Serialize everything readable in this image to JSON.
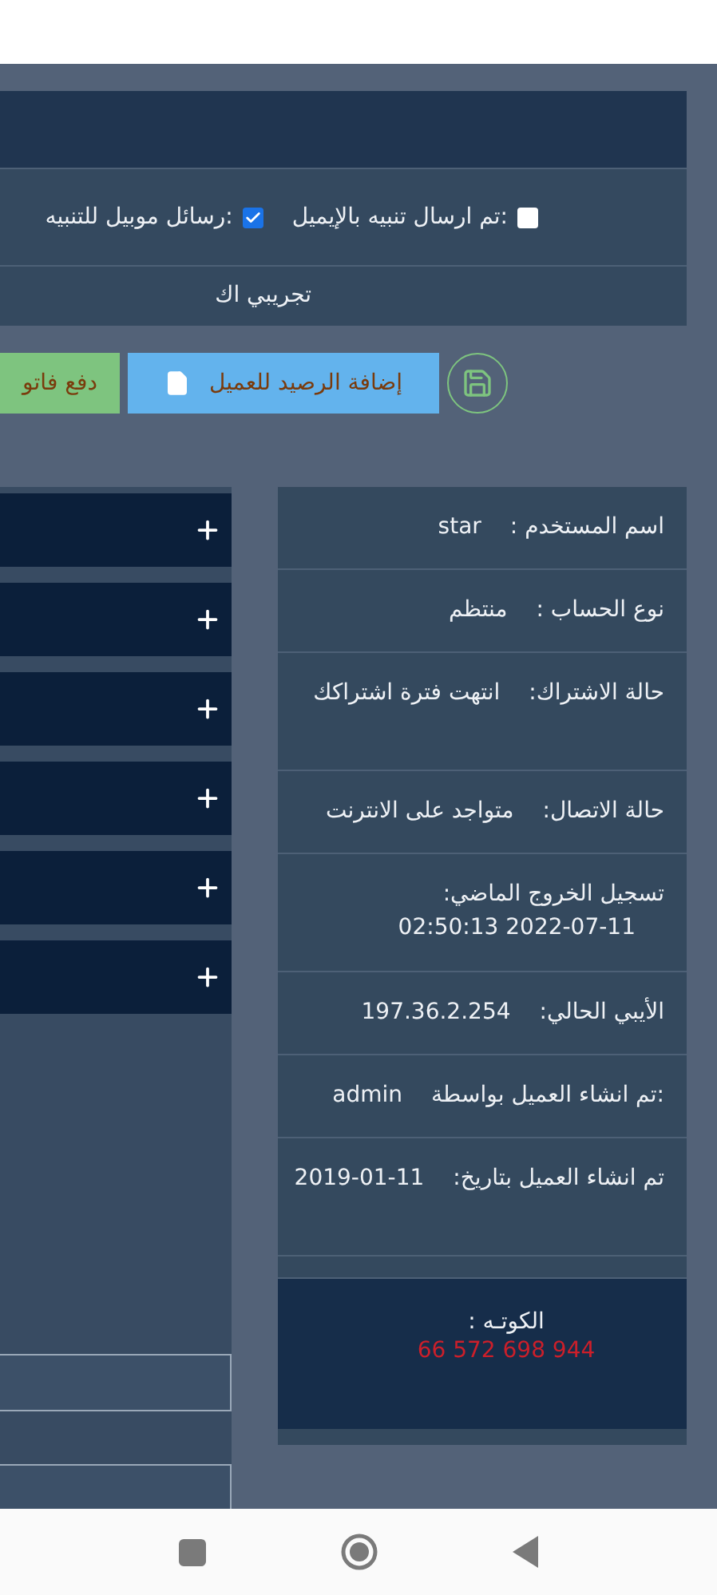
{
  "alerts": [
    {
      "label": ":تم ارسال تنبيه بالإيميل",
      "checked": false
    },
    {
      "label": ":رسائل موبيل للتنبيه",
      "checked": true
    }
  ],
  "note": "تجريبي اك",
  "buttons": [
    {
      "kind": "save"
    },
    {
      "kind": "primary",
      "label": "إضافة الرصيد للعميل"
    },
    {
      "kind": "success",
      "label": "دفع فاتو"
    }
  ],
  "sections": [
    {
      "expanded": false
    },
    {
      "expanded": false
    },
    {
      "expanded": false
    },
    {
      "expanded": false
    },
    {
      "expanded": false
    },
    {
      "expanded": false
    }
  ],
  "info_rows": [
    {
      "label": "اسم المستخدم :",
      "value": "star"
    },
    {
      "label": "نوع الحساب :",
      "value": "منتظم"
    },
    {
      "label": "حالة الاشتراك:",
      "value": "انتهت فترة اشتراكك"
    },
    {
      "label": "حالة الاتصال:",
      "value": "متواجد على الانترنت"
    },
    {
      "label": "تسجيل الخروج الماضي:",
      "value": "2022-07-11 02:50:13"
    },
    {
      "label": "الأيبي الحالي:",
      "value": "197.36.2.254"
    },
    {
      "label": ":تم انشاء العميل بواسطة",
      "value": "admin"
    },
    {
      "label": "تم انشاء العميل بتاريخ:",
      "value": "2019-01-11"
    }
  ],
  "quota": {
    "label": "الكوتـه :",
    "value": "66 572 698 944"
  }
}
